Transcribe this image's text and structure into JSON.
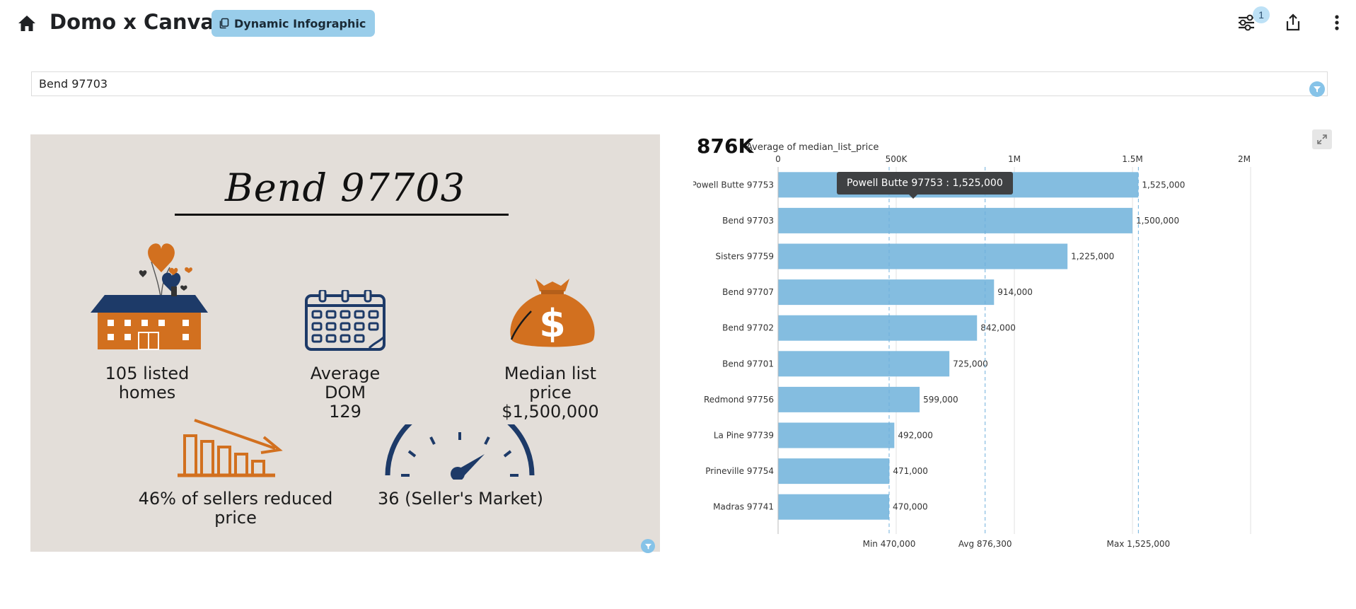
{
  "header": {
    "title": "Domo x Canva",
    "pill_label": "Dynamic Infographic",
    "filter_badge_count": "1"
  },
  "filter": {
    "value": "Bend 97703"
  },
  "infographic": {
    "title": "Bend 97703",
    "stats": {
      "listed_line1": "105 listed",
      "listed_line2": "homes",
      "dom_line1": "Average",
      "dom_line2": "DOM",
      "dom_line3": "129",
      "price_line1": "Median list",
      "price_line2": "price",
      "price_line3": "$1,500,000",
      "reduced_line1": "46% of sellers reduced",
      "reduced_line2": "price",
      "market": "36 (Seller's Market)"
    },
    "colors": {
      "background": "#e3ded9",
      "orange": "#d2701f",
      "navy": "#1d3a68"
    }
  },
  "chart_header": {
    "kpi_value": "876K",
    "kpi_label": "Average of median_list_price"
  },
  "tooltip": {
    "text": "Powell Butte 97753 : 1,525,000"
  },
  "chart_data": {
    "type": "bar",
    "orientation": "horizontal",
    "categories": [
      "Powell Butte 97753",
      "Bend 97703",
      "Sisters 97759",
      "Bend 97707",
      "Bend 97702",
      "Bend 97701",
      "Redmond 97756",
      "La Pine 97739",
      "Prineville 97754",
      "Madras 97741"
    ],
    "values": [
      1525000,
      1500000,
      1225000,
      914000,
      842000,
      725000,
      599000,
      492000,
      471000,
      470000
    ],
    "value_labels": [
      "1,525,000",
      "1,500,000",
      "1,225,000",
      "914,000",
      "842,000",
      "725,000",
      "599,000",
      "492,000",
      "471,000",
      "470,000"
    ],
    "xlim": [
      0,
      2000000
    ],
    "ticks": [
      0,
      500000,
      1000000,
      1500000,
      2000000
    ],
    "tick_labels": [
      "0",
      "500K",
      "1M",
      "1.5M",
      "2M"
    ],
    "reference_lines": [
      {
        "label": "Min 470,000",
        "value": 470000
      },
      {
        "label": "Avg 876,300",
        "value": 876300
      },
      {
        "label": "Max 1,525,000",
        "value": 1525000
      }
    ],
    "bar_color": "#84bde0",
    "grid": true
  }
}
